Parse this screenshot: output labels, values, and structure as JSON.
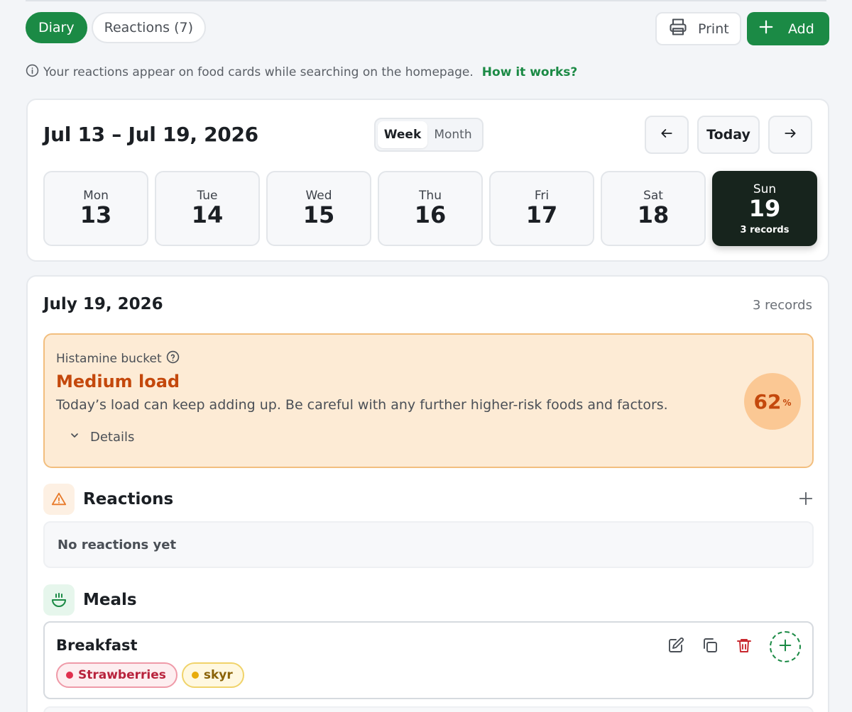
{
  "tabs": [
    {
      "label": "Diary",
      "active": true
    },
    {
      "label": "Reactions (7)",
      "active": false
    }
  ],
  "actions": {
    "print_label": "Print",
    "add_label": "Add"
  },
  "info": {
    "text": "Your reactions appear on food cards while searching on the homepage.",
    "link": "How it works?"
  },
  "week": {
    "range": "Jul 13 – Jul 19, 2026",
    "view_toggle": [
      "Week",
      "Month"
    ],
    "today_label": "Today",
    "days": [
      {
        "name": "Mon",
        "date": "13"
      },
      {
        "name": "Tue",
        "date": "14"
      },
      {
        "name": "Wed",
        "date": "15"
      },
      {
        "name": "Thu",
        "date": "16"
      },
      {
        "name": "Fri",
        "date": "17"
      },
      {
        "name": "Sat",
        "date": "18"
      },
      {
        "name": "Sun",
        "date": "19",
        "records": "3 records",
        "selected": true
      }
    ]
  },
  "day": {
    "title": "July 19, 2026",
    "records": "3 records",
    "bucket": {
      "label": "Histamine bucket",
      "load": "Medium load",
      "description": "Today’s load can keep adding up. Be careful with any further higher-risk foods and factors.",
      "details_label": "Details",
      "percent_value": "62",
      "percent_sign": "%"
    },
    "reactions": {
      "title": "Reactions",
      "empty": "No reactions yet"
    },
    "meals": {
      "title": "Meals",
      "items": [
        {
          "name": "Breakfast",
          "foods": [
            {
              "label": "Strawberries",
              "color": "#e0304e"
            },
            {
              "label": "skyr",
              "color": "#e8ab0a"
            }
          ]
        }
      ]
    }
  },
  "colors": {
    "accent": "#1b8a45",
    "warning": "#c4480c",
    "selected_day": "#17241d"
  }
}
